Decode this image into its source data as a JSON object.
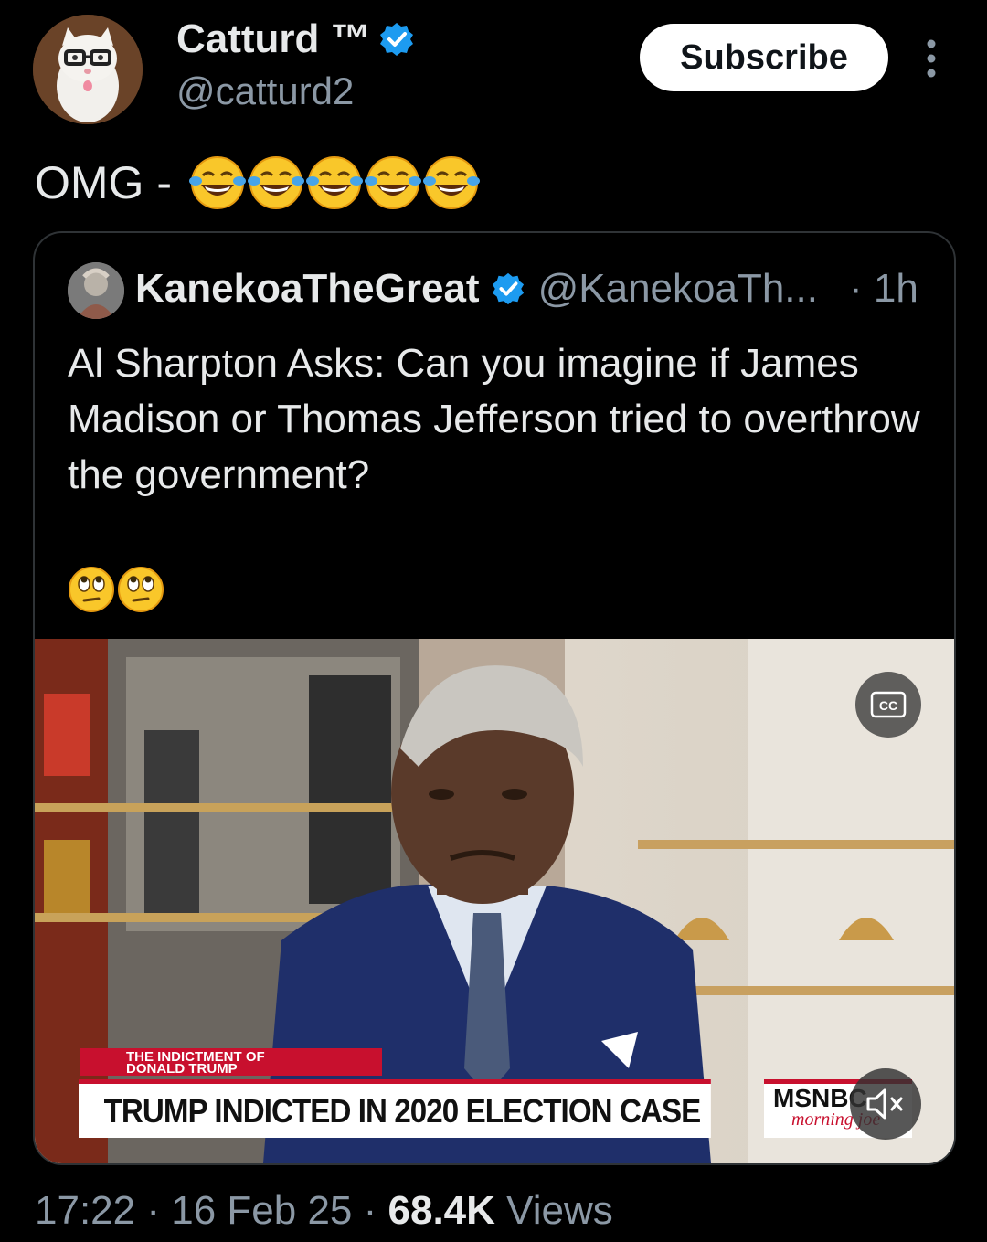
{
  "author": {
    "name": "Catturd ™",
    "handle": "@catturd2",
    "verified": true
  },
  "subscribe_label": "Subscribe",
  "post": {
    "text": "OMG -",
    "emojis": [
      "😂",
      "😂",
      "😂",
      "😂",
      "😂"
    ]
  },
  "quoted_post": {
    "name": "KanekoaTheGreat",
    "handle": "@KanekoaTh...",
    "time": "· 1h",
    "text": "Al Sharpton Asks: Can you imagine if James Madison or Thomas Jefferson tried to overthrow the government?",
    "emojis": [
      "🙄",
      "🙄"
    ],
    "video": {
      "chyron_small_line1": "The Indictment of",
      "chyron_small_line2": "Donald Trump",
      "chyron_main": "TRUMP INDICTED IN 2020 ELECTION CASE",
      "network": "MSNBC",
      "show": "morning joe",
      "cc_icon": "closed-captions-icon",
      "mute_icon": "muted-speaker-icon"
    }
  },
  "meta": {
    "time": "17:22",
    "date": "16 Feb 25",
    "views_count": "68.4K",
    "views_label": "Views",
    "separator": "·"
  },
  "colors": {
    "background": "#000000",
    "text": "#e7e9ea",
    "secondary": "#8b98a5",
    "verified": "#1d9bf0",
    "border": "#2f3336",
    "chyron_red": "#c8102e"
  }
}
